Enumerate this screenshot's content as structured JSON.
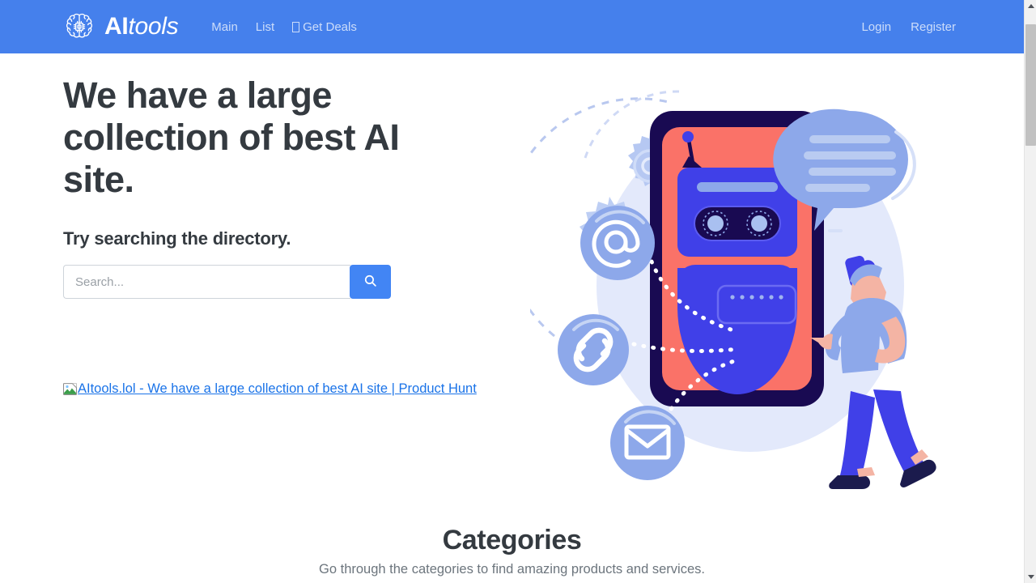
{
  "brand": {
    "logo_icon": "brain-chip-icon",
    "name_bold": "AI",
    "name_italic": "tools"
  },
  "nav": {
    "left_items": [
      {
        "label": "Main",
        "icon": null
      },
      {
        "label": "List",
        "icon": null
      },
      {
        "label": "Get Deals",
        "icon": "missing-glyph-box"
      }
    ],
    "right_items": [
      {
        "label": "Login"
      },
      {
        "label": "Register"
      }
    ]
  },
  "hero": {
    "headline": "We have a large collection of best AI site.",
    "subheading": "Try searching the directory.",
    "search": {
      "placeholder": "Search...",
      "value": "",
      "button_icon": "search-icon"
    },
    "product_hunt_badge_alt": "AItools.lol - We have a large collection of best AI site | Product Hunt",
    "illustration_alt": "chatbot-illustration"
  },
  "categories": {
    "title": "Categories",
    "subtitle": "Go through the categories to find amazing products and services."
  },
  "scrollbar": {
    "up_icon": "scroll-up-arrow-icon",
    "down_icon": "scroll-down-arrow-icon"
  },
  "colors": {
    "header_blue": "#4580ec",
    "accent_blue": "#4285f4",
    "link_blue": "#1a73e8",
    "heading_dark": "#343a40",
    "muted_text": "#6c757d",
    "illustration_coral": "#fa7268",
    "illustration_navy": "#190a52",
    "illustration_indigo": "#4040e8",
    "illustration_periwinkle": "#8da8ea",
    "illustration_bg": "#e3e9fb"
  }
}
